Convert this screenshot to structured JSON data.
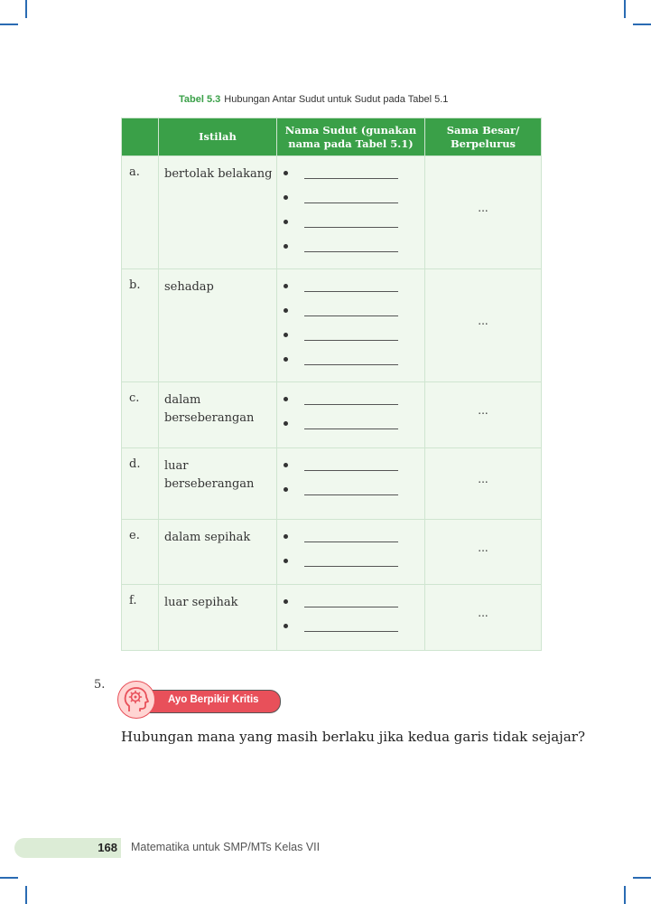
{
  "caption": {
    "label": "Tabel 5.3",
    "text": "Hubungan Antar Sudut untuk Sudut pada Tabel 5.1"
  },
  "table": {
    "headers": [
      "",
      "Istilah",
      "Nama Sudut (gunakan nama pada Tabel 5.1)",
      "Sama Besar/ Berpelurus"
    ],
    "rows": [
      {
        "letter": "a.",
        "term": "bertolak belakang",
        "blanks": 4,
        "answer": "..."
      },
      {
        "letter": "b.",
        "term": "sehadap",
        "blanks": 4,
        "answer": "..."
      },
      {
        "letter": "c.",
        "term": "dalam berseberangan",
        "blanks": 2,
        "answer": "..."
      },
      {
        "letter": "d.",
        "term": "luar berseberangan",
        "blanks": 2,
        "answer": "..."
      },
      {
        "letter": "e.",
        "term": "dalam sepihak",
        "blanks": 2,
        "answer": "..."
      },
      {
        "letter": "f.",
        "term": "luar sepihak",
        "blanks": 2,
        "answer": "..."
      }
    ]
  },
  "exercise": {
    "number": "5.",
    "badge_icon": "head-gear-icon",
    "badge_label": "Ayo Berpikir Kritis",
    "question": "Hubungan mana yang masih berlaku jika kedua garis tidak sejajar?"
  },
  "footer": {
    "page_number": "168",
    "book_title": "Matematika untuk SMP/MTs Kelas VII"
  },
  "colors": {
    "accent_green": "#3aa048",
    "badge_red": "#e8505a",
    "crop_marks": "#2a6bb3"
  }
}
